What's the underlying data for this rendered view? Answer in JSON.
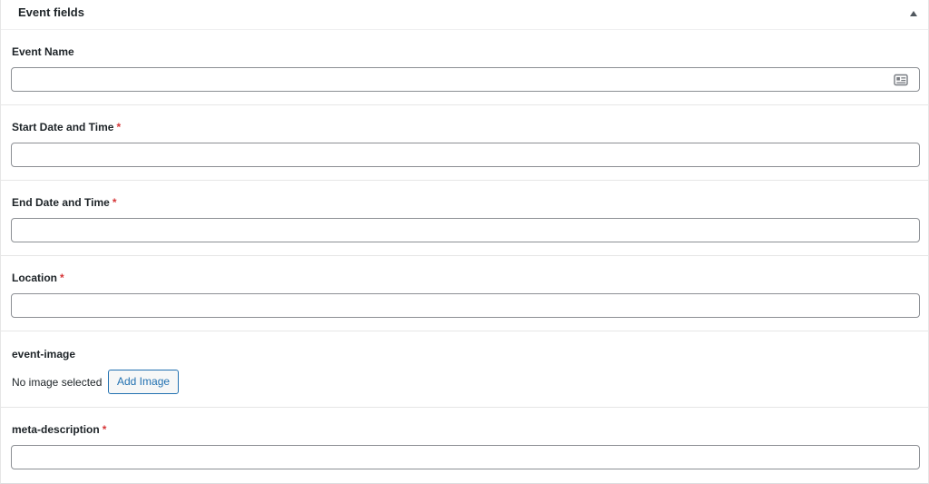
{
  "panel": {
    "title": "Event fields"
  },
  "fields": {
    "event_name": {
      "label": "Event Name",
      "value": "",
      "placeholder": ""
    },
    "start": {
      "label": "Start Date and Time",
      "required_mark": "*",
      "value": ""
    },
    "end": {
      "label": "End Date and Time",
      "required_mark": "*",
      "value": ""
    },
    "location": {
      "label": "Location",
      "required_mark": "*",
      "value": ""
    },
    "image": {
      "label": "event-image",
      "status": "No image selected",
      "button_label": "Add Image"
    },
    "meta": {
      "label": "meta-description",
      "required_mark": "*",
      "value": ""
    }
  },
  "icons": {
    "toggle": "triangle-up-icon",
    "contact_card": "contact-card-icon"
  },
  "colors": {
    "required": "#d63638",
    "button_accent": "#2271b1",
    "input_border": "#8c8f94"
  }
}
